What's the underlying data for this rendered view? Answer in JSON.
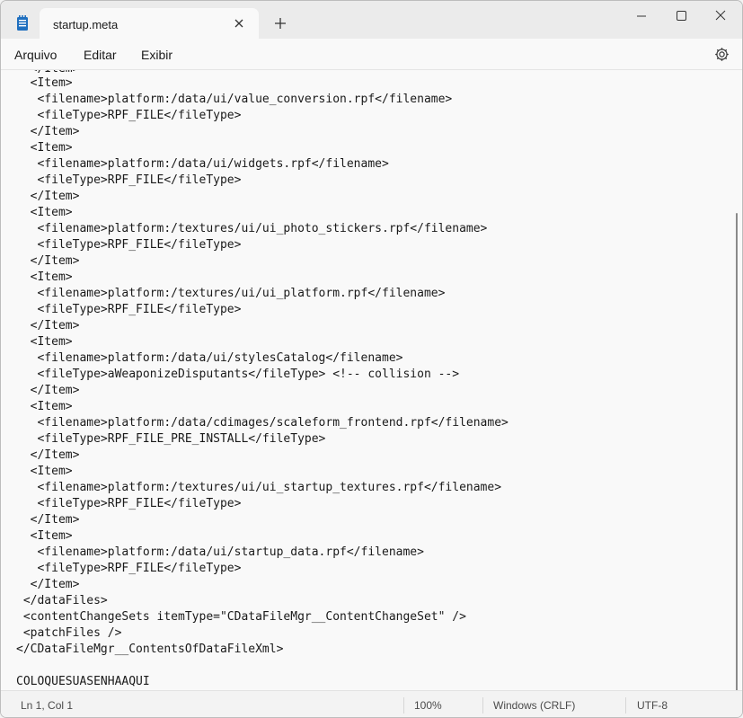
{
  "tab": {
    "title": "startup.meta"
  },
  "menu": {
    "file": "Arquivo",
    "edit": "Editar",
    "view": "Exibir"
  },
  "editor": {
    "lines": [
      "  </Item>",
      "  <Item>",
      "   <filename>platform:/data/ui/value_conversion.rpf</filename>",
      "   <fileType>RPF_FILE</fileType>",
      "  </Item>",
      "  <Item>",
      "   <filename>platform:/data/ui/widgets.rpf</filename>",
      "   <fileType>RPF_FILE</fileType>",
      "  </Item>",
      "  <Item>",
      "   <filename>platform:/textures/ui/ui_photo_stickers.rpf</filename>",
      "   <fileType>RPF_FILE</fileType>",
      "  </Item>",
      "  <Item>",
      "   <filename>platform:/textures/ui/ui_platform.rpf</filename>",
      "   <fileType>RPF_FILE</fileType>",
      "  </Item>",
      "  <Item>",
      "   <filename>platform:/data/ui/stylesCatalog</filename>",
      "   <fileType>aWeaponizeDisputants</fileType> <!-- collision -->",
      "  </Item>",
      "  <Item>",
      "   <filename>platform:/data/cdimages/scaleform_frontend.rpf</filename>",
      "   <fileType>RPF_FILE_PRE_INSTALL</fileType>",
      "  </Item>",
      "  <Item>",
      "   <filename>platform:/textures/ui/ui_startup_textures.rpf</filename>",
      "   <fileType>RPF_FILE</fileType>",
      "  </Item>",
      "  <Item>",
      "   <filename>platform:/data/ui/startup_data.rpf</filename>",
      "   <fileType>RPF_FILE</fileType>",
      "  </Item>",
      " </dataFiles>",
      " <contentChangeSets itemType=\"CDataFileMgr__ContentChangeSet\" />",
      " <patchFiles />",
      "</CDataFileMgr__ContentsOfDataFileXml>",
      "",
      "COLOQUESUASENHAAQUI"
    ]
  },
  "status": {
    "position": "Ln 1, Col 1",
    "zoom": "100%",
    "line_ending": "Windows (CRLF)",
    "encoding": "UTF-8"
  },
  "icons": {
    "app": "notepad-icon",
    "tab_close": "close-icon",
    "new_tab": "plus-icon",
    "minimize": "minimize-icon",
    "maximize": "maximize-icon",
    "close": "close-icon",
    "settings": "gear-icon"
  },
  "colors": {
    "app_icon": "#1f6fbf",
    "text": "#1a1a1a",
    "scrollbar": "#8a8a8a"
  }
}
